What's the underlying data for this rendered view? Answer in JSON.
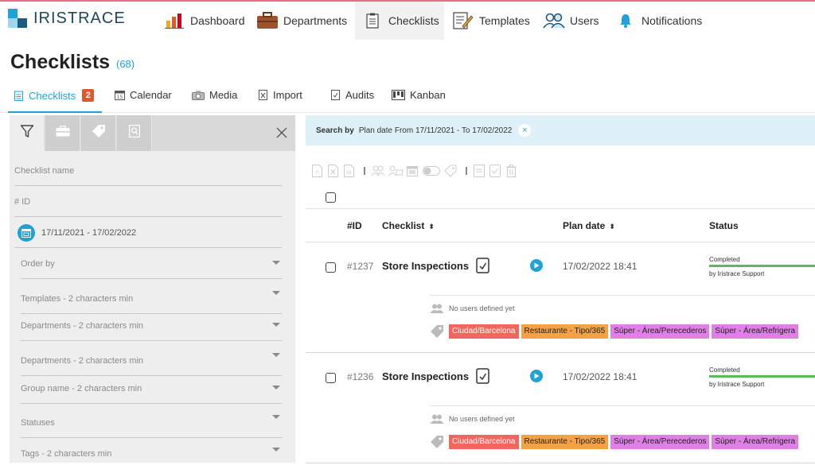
{
  "app": {
    "name": "IRISTRACE"
  },
  "nav": {
    "items": [
      {
        "label": "Dashboard",
        "icon": "bar-chart-icon"
      },
      {
        "label": "Departments",
        "icon": "briefcase-icon"
      },
      {
        "label": "Checklists",
        "icon": "checklist-icon"
      },
      {
        "label": "Templates",
        "icon": "template-edit-icon"
      },
      {
        "label": "Users",
        "icon": "users-icon"
      },
      {
        "label": "Notifications",
        "icon": "bell-icon"
      }
    ],
    "active": "Checklists"
  },
  "page": {
    "title": "Checklists",
    "count": "(68)"
  },
  "subtabs": {
    "items": [
      {
        "label": "Checklists",
        "badge": "2"
      },
      {
        "label": "Calendar"
      },
      {
        "label": "Media"
      },
      {
        "label": "Import"
      },
      {
        "label": "Audits"
      },
      {
        "label": "Kanban"
      }
    ]
  },
  "filters": {
    "checklist_name_placeholder": "Checklist name",
    "id_placeholder": "# ID",
    "date_range": "17/11/2021 - 17/02/2022",
    "order_by": "Order by",
    "templates": "Templates - 2 characters min",
    "departments_1": "Departments - 2 characters min",
    "departments_2": "Departments - 2 characters min",
    "group_name": "Group name - 2 characters min",
    "statuses": "Statuses",
    "tags": "Tags - 2 characters min"
  },
  "search": {
    "label": "Search by",
    "value": "Plan date From 17/11/2021 - To 17/02/2022",
    "clear": "×"
  },
  "table": {
    "headers": {
      "id": "#ID",
      "checklist": "Checklist",
      "plan_date": "Plan date",
      "status": "Status"
    },
    "sort_glyph": "⬍",
    "rows": [
      {
        "id": "#1237",
        "name": "Store Inspections",
        "plan_date": "17/02/2022 18:41",
        "status": "Completed",
        "status_by": "by Iristrace Support",
        "users": "No users defined yet",
        "tags": [
          {
            "label": "Ciudad/Barcelona",
            "color": "#f2665e"
          },
          {
            "label": "Restaurante - Tipo/365",
            "color": "#f5a244"
          },
          {
            "label": "Súper - Área/Perecederos",
            "color": "#e080e6"
          },
          {
            "label": "Súper - Área/Refrigera",
            "color": "#e080e6"
          }
        ]
      },
      {
        "id": "#1236",
        "name": "Store Inspections",
        "plan_date": "17/02/2022 18:41",
        "status": "Completed",
        "status_by": "by Iristrace Support",
        "users": "No users defined yet",
        "tags": [
          {
            "label": "Ciudad/Barcelona",
            "color": "#f2665e"
          },
          {
            "label": "Restaurante - Tipo/365",
            "color": "#f5a244"
          },
          {
            "label": "Súper - Área/Perecederos",
            "color": "#e080e6"
          },
          {
            "label": "Súper - Área/Refrigera",
            "color": "#e080e6"
          }
        ]
      }
    ]
  },
  "colors": {
    "accent": "#1fa2d6",
    "badge": "#e3572d",
    "status_completed": "#5cb85c",
    "banner": "#dff1f8"
  }
}
